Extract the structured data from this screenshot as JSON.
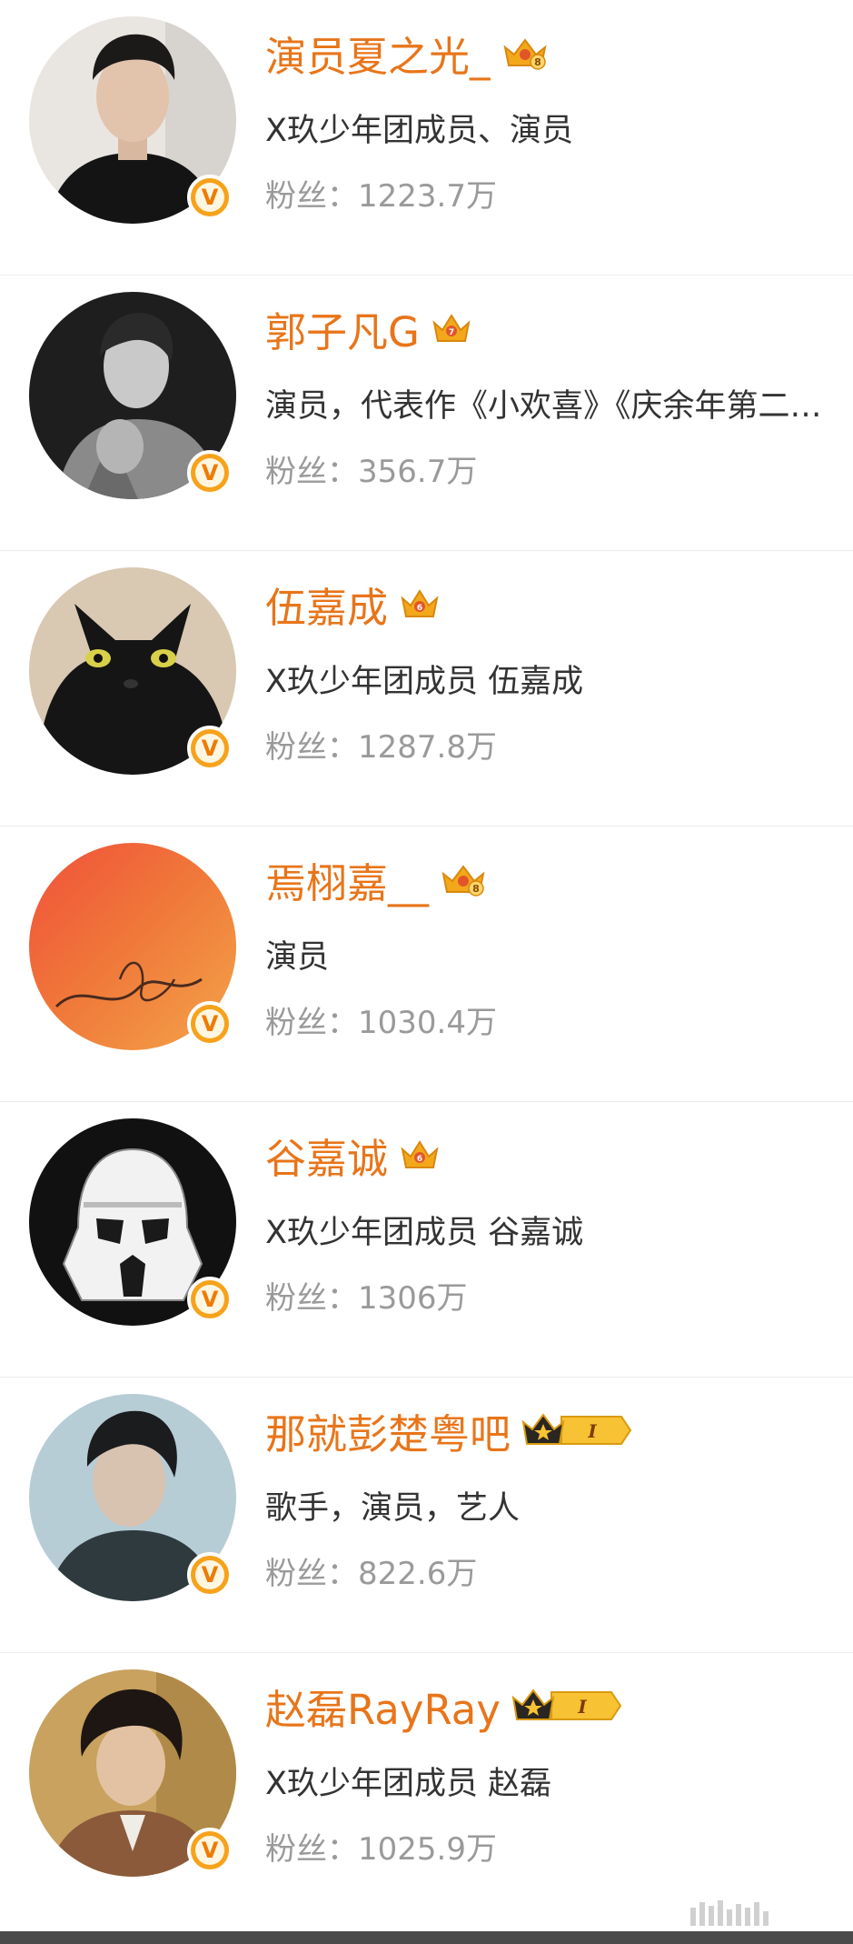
{
  "colors": {
    "name": "#e8751a",
    "desc": "#333333",
    "fans": "#9a9a9a",
    "badge": "#f7a21b"
  },
  "users": [
    {
      "name": "演员夏之光_",
      "desc": "X玖少年团成员、演员",
      "fans": "粉丝：1223.7万",
      "crown": "crown-8",
      "crown_level": "8",
      "avatar_icon": "portrait-man-black-shirt"
    },
    {
      "name": "郭子凡G",
      "desc": "演员，代表作《小欢喜》《庆余年第二…",
      "fans": "粉丝：356.7万",
      "crown": "crown-7",
      "crown_level": "7",
      "avatar_icon": "portrait-man-grayscale"
    },
    {
      "name": "伍嘉成",
      "desc": "X玖少年团成员  伍嘉成",
      "fans": "粉丝：1287.8万",
      "crown": "crown-6",
      "crown_level": "6",
      "avatar_icon": "black-cat"
    },
    {
      "name": "焉栩嘉__",
      "desc": "演员",
      "fans": "粉丝：1030.4万",
      "crown": "crown-8",
      "crown_level": "8",
      "avatar_icon": "red-orange-watercolor-signature"
    },
    {
      "name": "谷嘉诚",
      "desc": "X玖少年团成员  谷嘉诚",
      "fans": "粉丝：1306万",
      "crown": "crown-6",
      "crown_level": "6",
      "avatar_icon": "stormtrooper-helmet"
    },
    {
      "name": "那就彭楚粤吧",
      "desc": "歌手，演员，艺人",
      "fans": "粉丝：822.6万",
      "crown": "vip-crown-I",
      "vip_level": "I",
      "avatar_icon": "portrait-man-blue-tone"
    },
    {
      "name": "赵磊RayRay",
      "desc": "X玖少年团成员 赵磊",
      "fans": "粉丝：1025.9万",
      "crown": "vip-crown-I",
      "vip_level": "I",
      "avatar_icon": "portrait-man-curly-hair"
    }
  ],
  "verified_badge": "V"
}
